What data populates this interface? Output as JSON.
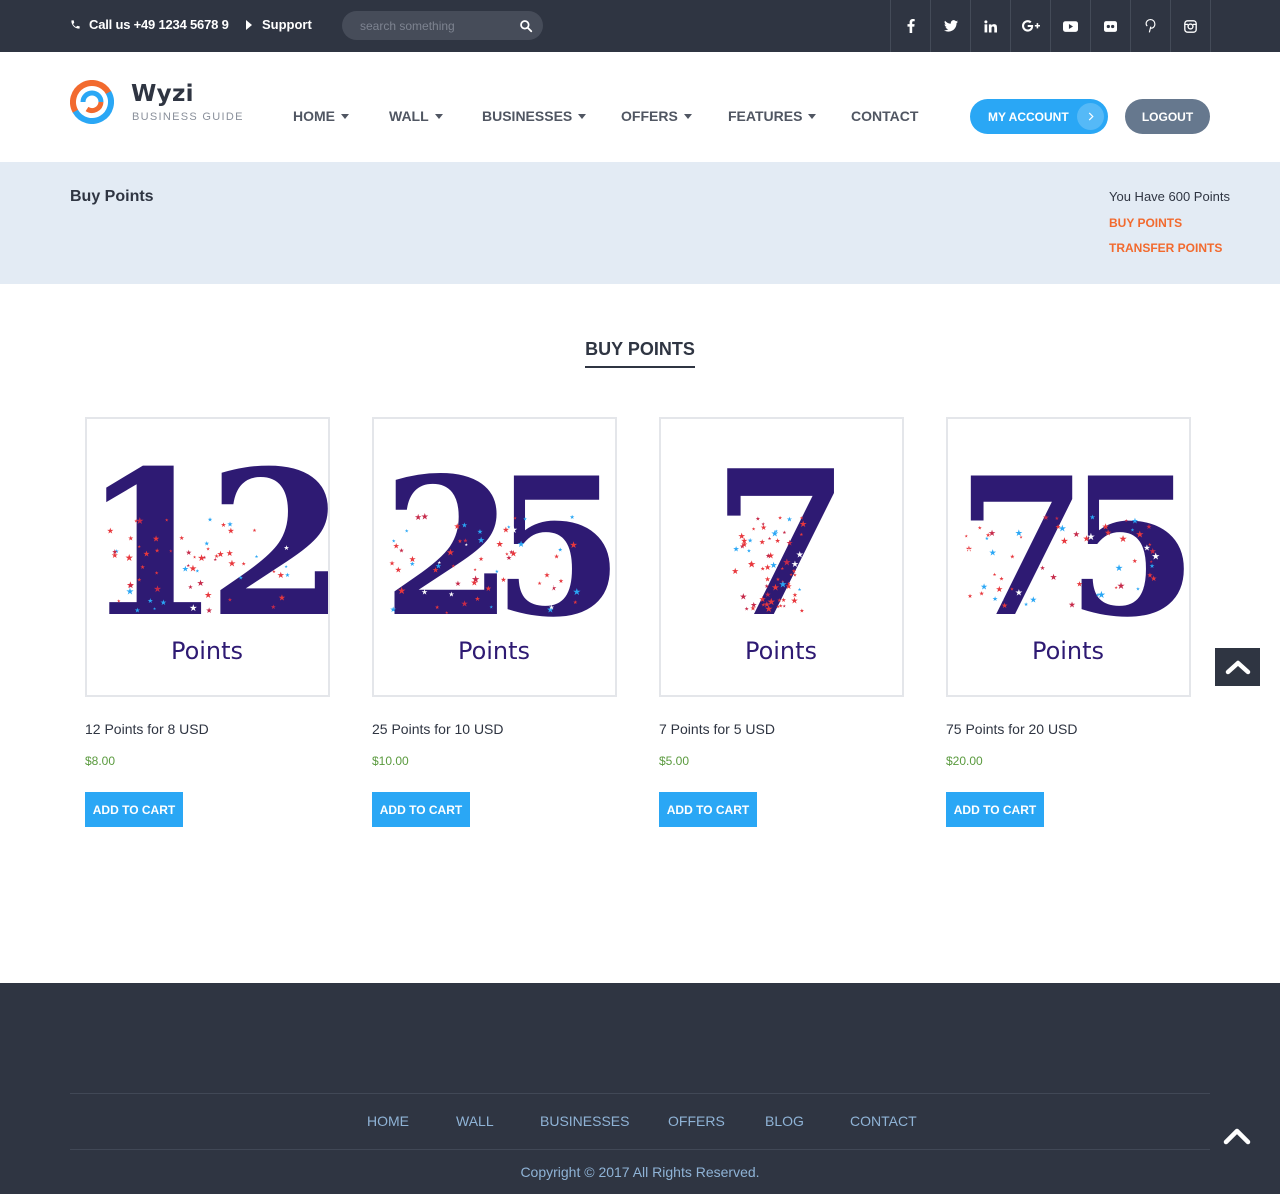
{
  "topbar": {
    "phone": "Call us +49 1234 5678 9",
    "support": "Support",
    "search_placeholder": "search something",
    "social": [
      "f",
      "t",
      "in",
      "G+",
      "yt",
      "fl",
      "p",
      "ig"
    ]
  },
  "header": {
    "brand": "Wyzi",
    "tagline": "BUSINESS GUIDE",
    "nav": [
      {
        "label": "HOME",
        "dropdown": true
      },
      {
        "label": "WALL",
        "dropdown": true
      },
      {
        "label": "BUSINESSES",
        "dropdown": true
      },
      {
        "label": "OFFERS",
        "dropdown": true
      },
      {
        "label": "FEATURES",
        "dropdown": true
      },
      {
        "label": "CONTACT",
        "dropdown": false
      }
    ],
    "my_account": "MY ACCOUNT",
    "logout": "LOGOUT"
  },
  "band": {
    "title": "Buy Points",
    "points_text": "You Have 600 Points",
    "buy_points": "BUY POINTS",
    "transfer_points": "TRANSFER POINTS"
  },
  "section": {
    "title": "BUY POINTS"
  },
  "products": [
    {
      "number": "12",
      "img_label": "Points",
      "name": "12 Points for 8 USD",
      "price": "$8.00",
      "button": "ADD TO CART"
    },
    {
      "number": "25",
      "img_label": "Points",
      "name": "25 Points for 10 USD",
      "price": "$10.00",
      "button": "ADD TO CART"
    },
    {
      "number": "7",
      "img_label": "Points",
      "name": "7 Points for 5 USD",
      "price": "$5.00",
      "button": "ADD TO CART"
    },
    {
      "number": "75",
      "img_label": "Points",
      "name": "75 Points for 20 USD",
      "price": "$20.00",
      "button": "ADD TO CART"
    }
  ],
  "footer": {
    "nav": [
      "HOME",
      "WALL",
      "BUSINESSES",
      "OFFERS",
      "BLOG",
      "CONTACT"
    ],
    "copyright": "Copyright © 2017 All Rights Reserved."
  },
  "colors": {
    "dark": "#2f3542",
    "accent_blue": "#2aa7f5",
    "accent_orange": "#f26a2e",
    "number_purple": "#2e1a73",
    "price_green": "#5a9a3e"
  }
}
